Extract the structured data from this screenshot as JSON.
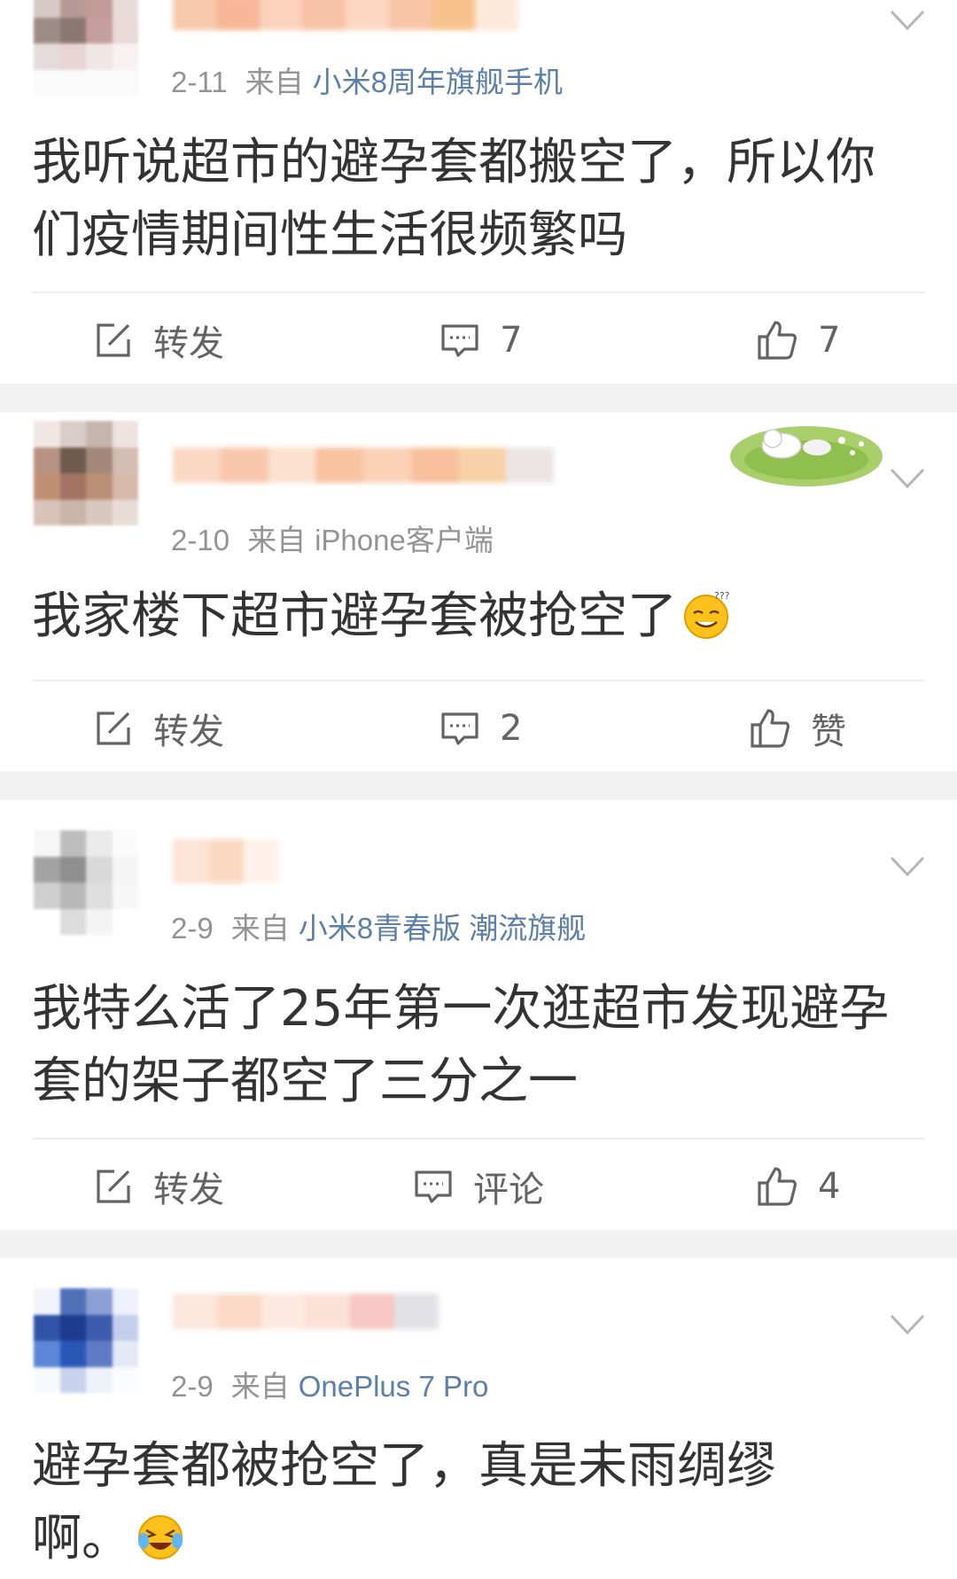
{
  "posts": [
    {
      "date": "2-11",
      "source_label": "来自",
      "source": "小米8周年旗舰手机",
      "text": "我听说超市的避孕套都搬空了，所以你们疫情期间性生活很频繁吗",
      "actions": {
        "repost": "转发",
        "comment": "7",
        "like": "7"
      }
    },
    {
      "date": "2-10",
      "source_label": "来自",
      "source": "iPhone客户端",
      "text": "我家楼下超市避孕套被抢空了",
      "emoji": "confused-smile-emoji",
      "actions": {
        "repost": "转发",
        "comment": "2",
        "like": "赞"
      }
    },
    {
      "date": "2-9",
      "source_label": "来自",
      "source": "小米8青春版 潮流旗舰",
      "text": "我特么活了25年第一次逛超市发现避孕套的架子都空了三分之一",
      "actions": {
        "repost": "转发",
        "comment": "评论",
        "like": "4"
      }
    },
    {
      "date": "2-9",
      "source_label": "来自",
      "source": "OnePlus 7 Pro",
      "text": "避孕套都被抢空了，真是未雨绸缪啊。",
      "emoji": "laughing-crying-emoji"
    }
  ],
  "colors": {
    "source_link": "#5b7fa8",
    "meta_gray": "#939393",
    "text": "#333333",
    "action_gray": "#636363",
    "separator": "#f2f2f2"
  },
  "icons": {
    "repost": "edit-square-icon",
    "comment": "comment-bubble-icon",
    "like": "thumbs-up-icon",
    "menu": "chevron-down-icon"
  }
}
